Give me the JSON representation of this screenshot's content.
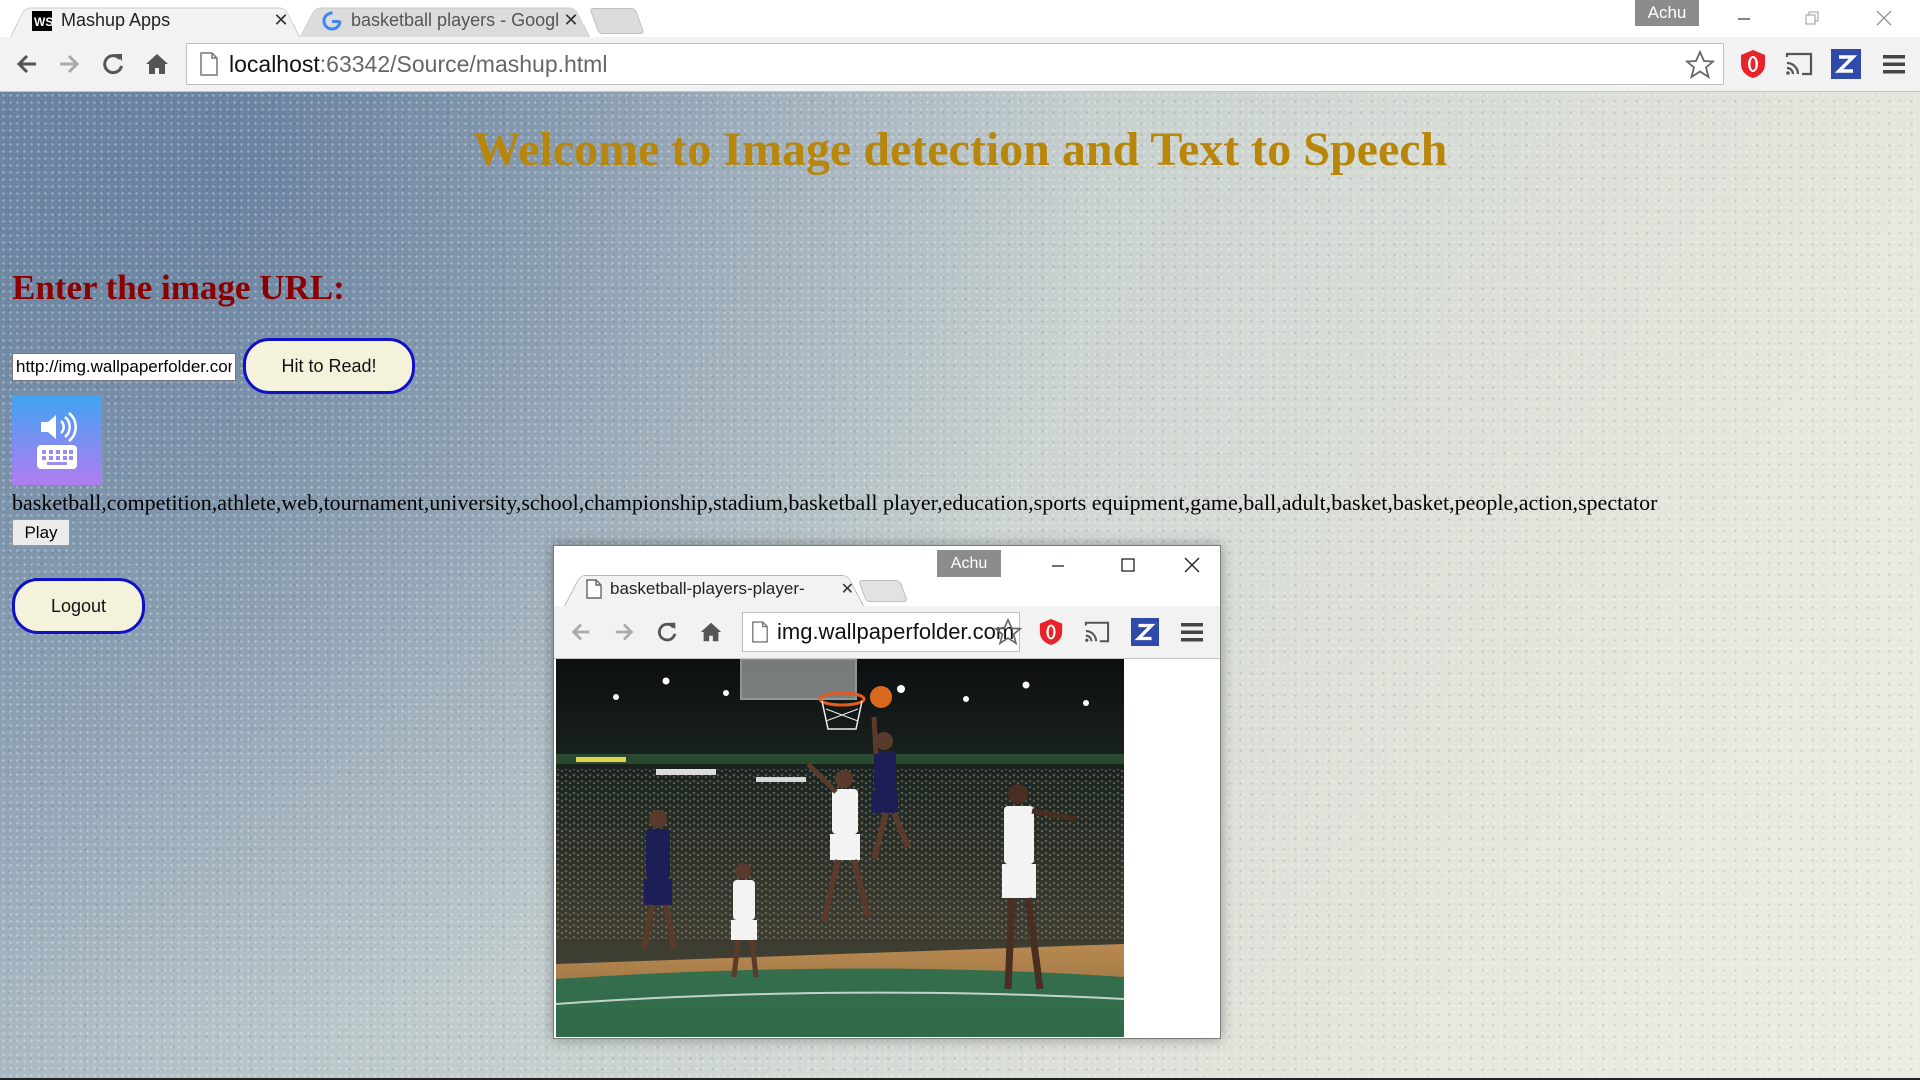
{
  "browser": {
    "tabs": [
      {
        "title": "Mashup Apps",
        "favicon": "webstorm-ws-icon",
        "active": true
      },
      {
        "title": "basketball players - Googl",
        "favicon": "google-g-icon",
        "active": false
      }
    ],
    "profile_name": "Achu",
    "url_host": "localhost",
    "url_rest": ":63342/Source/mashup.html",
    "colors": {
      "toolbar": "#f2f2f2",
      "ext_red": "#e8232a",
      "ext_blue": "#2f4aa8"
    }
  },
  "page": {
    "heading": "Welcome to Image detection and Text to Speech",
    "prompt_label": "Enter the image URL:",
    "url_input_value": "http://img.wallpaperfolder.com",
    "read_button": "Hit to Read!",
    "tts_icon": "speaker-keyboard-icon",
    "tags_text": "basketball,competition,athlete,web,tournament,university,school,championship,stadium,basketball player,education,sports equipment,game,ball,adult,basket,basket,people,action,spectator",
    "play_button": "Play",
    "logout_button": "Logout",
    "colors": {
      "heading": "#b8860b",
      "label": "#8b0000",
      "button_border": "#1010c8",
      "button_bg": "#f5f2dc"
    }
  },
  "popup": {
    "profile_name": "Achu",
    "tab_title": "basketball-players-player-",
    "url": "img.wallpaperfolder.com",
    "image": "basketball-game-photo"
  }
}
